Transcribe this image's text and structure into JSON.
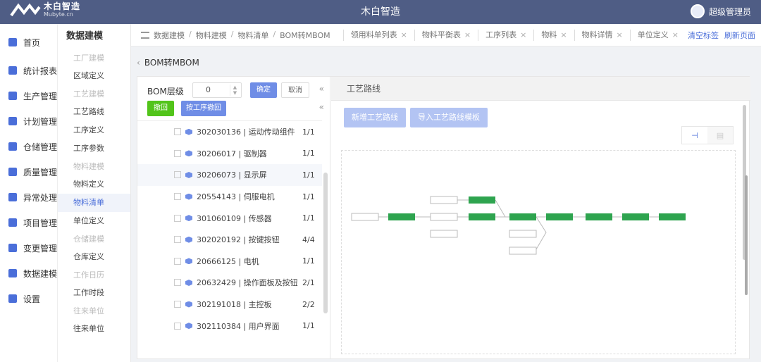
{
  "header": {
    "logo_cn": "木白智造",
    "logo_en": "Mubyte.cn",
    "title": "木白智造",
    "user": "超级管理员"
  },
  "nav": [
    {
      "label": "首页",
      "icon": "home-icon"
    },
    {
      "label": "统计报表",
      "icon": "chart-icon"
    },
    {
      "label": "生产管理",
      "icon": "factory-icon"
    },
    {
      "label": "计划管理",
      "icon": "calendar-icon"
    },
    {
      "label": "仓储管理",
      "icon": "warehouse-icon"
    },
    {
      "label": "质量管理",
      "icon": "quality-icon"
    },
    {
      "label": "异常处理",
      "icon": "alert-icon"
    },
    {
      "label": "项目管理",
      "icon": "project-icon"
    },
    {
      "label": "变更管理",
      "icon": "change-icon"
    },
    {
      "label": "数据建模",
      "icon": "database-icon"
    },
    {
      "label": "设置",
      "icon": "gear-icon"
    }
  ],
  "subnav": {
    "title": "数据建模",
    "g1": "工厂建模",
    "i1": "区域定义",
    "g2": "工艺建模",
    "i2": "工艺路线",
    "i3": "工序定义",
    "i4": "工序参数",
    "g3": "物料建模",
    "i5": "物料定义",
    "i6": "物料清单",
    "i7": "单位定义",
    "g4": "仓储建模",
    "i8": "仓库定义",
    "g5": "工作日历",
    "i9": "工作时段",
    "g6": "往来单位",
    "i10": "往来单位"
  },
  "breadcrumb": [
    "数据建模",
    "物料建模",
    "物料清单",
    "BOM转MBOM"
  ],
  "tabs": [
    "领用料单列表",
    "物料平衡表",
    "工序列表",
    "物料",
    "物料详情",
    "单位定义"
  ],
  "tab_tools": {
    "clear": "清空标签",
    "refresh": "刷新页面"
  },
  "page": {
    "title": "BOM转MBOM",
    "bom_level_label": "BOM层级",
    "bom_level_value": "0",
    "confirm": "确定",
    "cancel": "取消",
    "undo": "撤回",
    "by_process_undo": "按工序撤回"
  },
  "tree": [
    {
      "name": "302030136 | 运动传动组件",
      "qty": "1/1"
    },
    {
      "name": "30206017 | 驱制器",
      "qty": "1/1"
    },
    {
      "name": "30206073 | 显示屏",
      "qty": "1/1"
    },
    {
      "name": "20554143 | 伺服电机",
      "qty": "1/1"
    },
    {
      "name": "301060109 | 传感器",
      "qty": "1/1"
    },
    {
      "name": "302020192 | 按键按钮",
      "qty": "4/4"
    },
    {
      "name": "20666125 | 电机",
      "qty": "1/1"
    },
    {
      "name": "20632429 | 操作面板及按钮",
      "qty": "2/1"
    },
    {
      "name": "302191018 | 主控板",
      "qty": "2/2"
    },
    {
      "name": "302110384 | 用户界面",
      "qty": "1/1"
    }
  ],
  "route": {
    "title": "工艺路线",
    "new_btn": "新增工艺路线",
    "import_btn": "导入工艺路线模板",
    "view_flow_icon": "flow-icon",
    "view_table_icon": "table-icon"
  },
  "colors": {
    "header": "#4f5d85",
    "accent": "#4a6ed9",
    "green": "#52c41a",
    "node_green": "#2ea44f"
  }
}
